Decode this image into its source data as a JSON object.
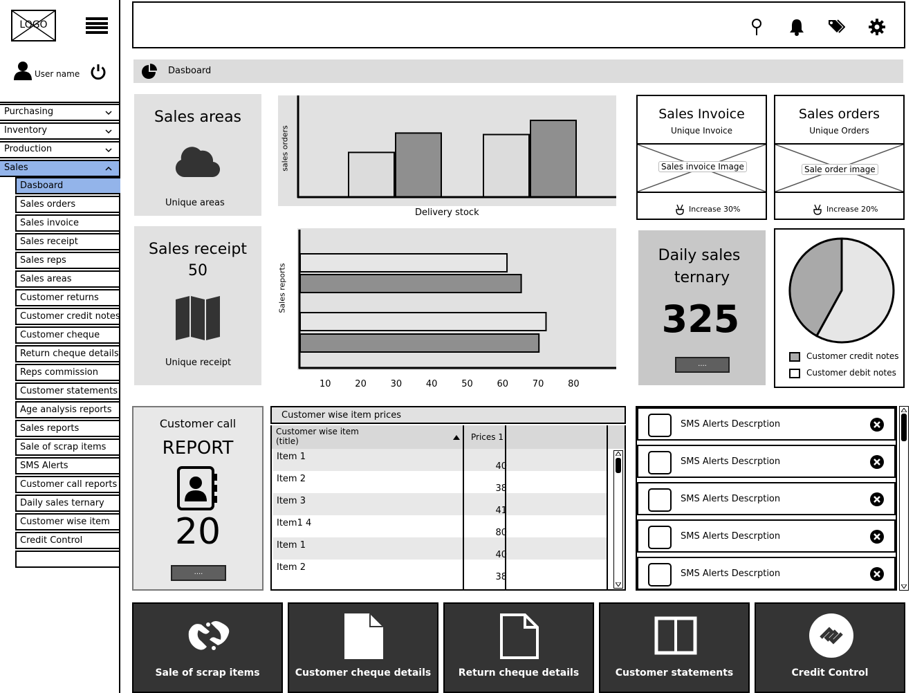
{
  "logo": {
    "text": "LOGO"
  },
  "user": {
    "name": "User name"
  },
  "sidebar": {
    "categories": [
      {
        "label": "Purchasing"
      },
      {
        "label": "Inventory"
      },
      {
        "label": "Production"
      },
      {
        "label": "Sales"
      }
    ],
    "sales_items": [
      "Dasboard",
      "Sales orders",
      "Sales invoice",
      "Sales receipt",
      "Sales reps",
      "Sales areas",
      "Customer returns",
      "Customer credit notes",
      "Customer cheque",
      "Return cheque details",
      "Reps commission",
      "Customer statements",
      "Age analysis reports",
      "Sales reports",
      "Sale of scrap items",
      "SMS Alerts",
      "Customer call reports",
      "Daily sales ternary",
      "Customer wise item",
      "Credit Control",
      ""
    ]
  },
  "header": {
    "icons": [
      "pin-icon",
      "bell-icon",
      "tags-icon",
      "gear-icon"
    ]
  },
  "breadcrumb": {
    "label": "Dasboard"
  },
  "sales_areas": {
    "title": "Sales areas",
    "subtitle": "Unique areas"
  },
  "sales_receipt": {
    "title": "Sales receipt",
    "value": "50",
    "subtitle": "Unique receipt"
  },
  "sales_invoice": {
    "title": "Sales Invoice",
    "subtitle": "Unique Invoice",
    "image_label": "Sales invoice Image",
    "footer": "Increase 30%"
  },
  "sales_orders": {
    "title": "Sales orders",
    "subtitle": "Unique Orders",
    "image_label": "Sale order image",
    "footer": "Increase 20%"
  },
  "daily_sales": {
    "title_line1": "Daily sales",
    "title_line2": "ternary",
    "value": "325",
    "button": "...."
  },
  "customer_call": {
    "title": "Customer call",
    "subtitle": "REPORT",
    "value": "20",
    "button": "...."
  },
  "chart_data": [
    {
      "type": "bar",
      "xlabel": "Delivery stock",
      "ylabel": "sales orders",
      "series": [
        {
          "values": [
            60,
            86
          ]
        },
        {
          "values": [
            84,
            103
          ]
        }
      ],
      "colors": [
        "#dcdcdc",
        "#8f8f8f"
      ]
    },
    {
      "type": "bar",
      "orientation": "horizontal",
      "ylabel": "Sales reports",
      "xticks": [
        "10",
        "20",
        "30",
        "40",
        "50",
        "60",
        "70",
        "80"
      ],
      "values": [
        72,
        76,
        83,
        81
      ],
      "colors": [
        "#e6e6e6",
        "#8f8f8f",
        "#e6e6e6",
        "#8f8f8f"
      ],
      "xlim": [
        0,
        86
      ]
    },
    {
      "type": "pie",
      "values": [
        42,
        58
      ],
      "legend": [
        "Customer credit notes",
        "Customer debit notes"
      ],
      "colors": [
        "#a9a9a9",
        "#e6e6e6"
      ]
    }
  ],
  "price_table": {
    "title": "Customer wise item prices",
    "col1": "Customer wise item",
    "col1b": "(title)",
    "col2": "Prices 1",
    "rows": [
      {
        "name": "Item 1",
        "price": "40"
      },
      {
        "name": "Item 2",
        "price": "38"
      },
      {
        "name": "Item 3",
        "price": "41"
      },
      {
        "name": "Item1 4",
        "price": "80"
      },
      {
        "name": "Item 1",
        "price": "40"
      },
      {
        "name": "Item 2",
        "price": "38"
      }
    ]
  },
  "sms_alerts": [
    "SMS Alerts Descrption",
    "SMS Alerts Descrption",
    "SMS Alerts Descrption",
    "SMS Alerts Descrption",
    "SMS Alerts Descrption"
  ],
  "tiles": [
    {
      "label": "Sale of scrap items",
      "icon": "hands-icon"
    },
    {
      "label": "Customer cheque details",
      "icon": "file-icon"
    },
    {
      "label": "Return cheque details",
      "icon": "file-outline-icon"
    },
    {
      "label": "Customer statements",
      "icon": "columns-icon"
    },
    {
      "label": "Credit Control",
      "icon": "credit-control-icon"
    }
  ]
}
